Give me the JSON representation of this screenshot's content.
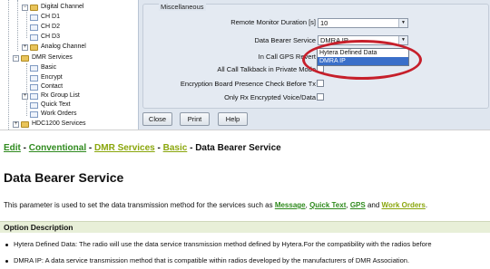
{
  "tree": {
    "items": [
      {
        "label": "Digital Channel",
        "kind": "folder"
      },
      {
        "label": "CH D1",
        "kind": "leaf"
      },
      {
        "label": "CH D2",
        "kind": "leaf"
      },
      {
        "label": "CH D3",
        "kind": "leaf"
      },
      {
        "label": "Analog Channel",
        "kind": "folder"
      },
      {
        "label": "DMR Services",
        "kind": "folder"
      },
      {
        "label": "Basic",
        "kind": "leaf"
      },
      {
        "label": "Encrypt",
        "kind": "leaf"
      },
      {
        "label": "Contact",
        "kind": "leaf"
      },
      {
        "label": "Rx Group List",
        "kind": "leaf"
      },
      {
        "label": "Quick Text",
        "kind": "leaf"
      },
      {
        "label": "Work Orders",
        "kind": "leaf"
      },
      {
        "label": "HDC1200 Services",
        "kind": "folder"
      }
    ]
  },
  "panel": {
    "group_title": "Miscellaneous",
    "fields": {
      "remote_monitor_label": "Remote Monitor Duration [s]",
      "remote_monitor_value": "10",
      "data_bearer_label": "Data Bearer Service",
      "data_bearer_value": "DMRA IP",
      "in_call_gps_label": "In Call GPS Revert",
      "all_call_label": "All Call Talkback in Private Mode",
      "encrypt_board_label": "Encryption Board Presence Check Before Tx",
      "only_rx_label": "Only Rx Encrypted Voice/Data"
    },
    "dropdown_options": [
      "Hytera Defined Data",
      "DMRA IP"
    ],
    "dropdown_selected_index": 1,
    "highlight_color": "#c61f2b",
    "buttons": {
      "close": "Close",
      "print": "Print",
      "help": "Help"
    }
  },
  "doc": {
    "breadcrumb": {
      "edit": "Edit",
      "sep1": " - ",
      "conventional": "Conventional",
      "sep2": " - ",
      "dmr_services": "DMR Services",
      "sep3": " - ",
      "basic": "Basic",
      "sep4": " - ",
      "current": "Data Bearer Service"
    },
    "title": "Data Bearer Service",
    "intro": {
      "text": "This parameter is used to set the data transmission method for the services such as ",
      "link1": "Message",
      "comma1": ", ",
      "link2": "Quick Text",
      "comma2": ", ",
      "link3": "GPS",
      "and": " and ",
      "link4": "Work Orders",
      "end": "."
    },
    "option_heading": "Option Description",
    "bullets": [
      "Hytera Defined Data: The radio will use the data service transmission method defined by Hytera.For the compatibility with the radios before",
      "DMRA IP: A data service transmission method that is compatible within radios developed by the manufacturers of DMR Association."
    ],
    "colors": {
      "link_green": "#2f8a1e",
      "link_yellow": "#8aa60c",
      "option_bar": "#e8efd8"
    }
  }
}
